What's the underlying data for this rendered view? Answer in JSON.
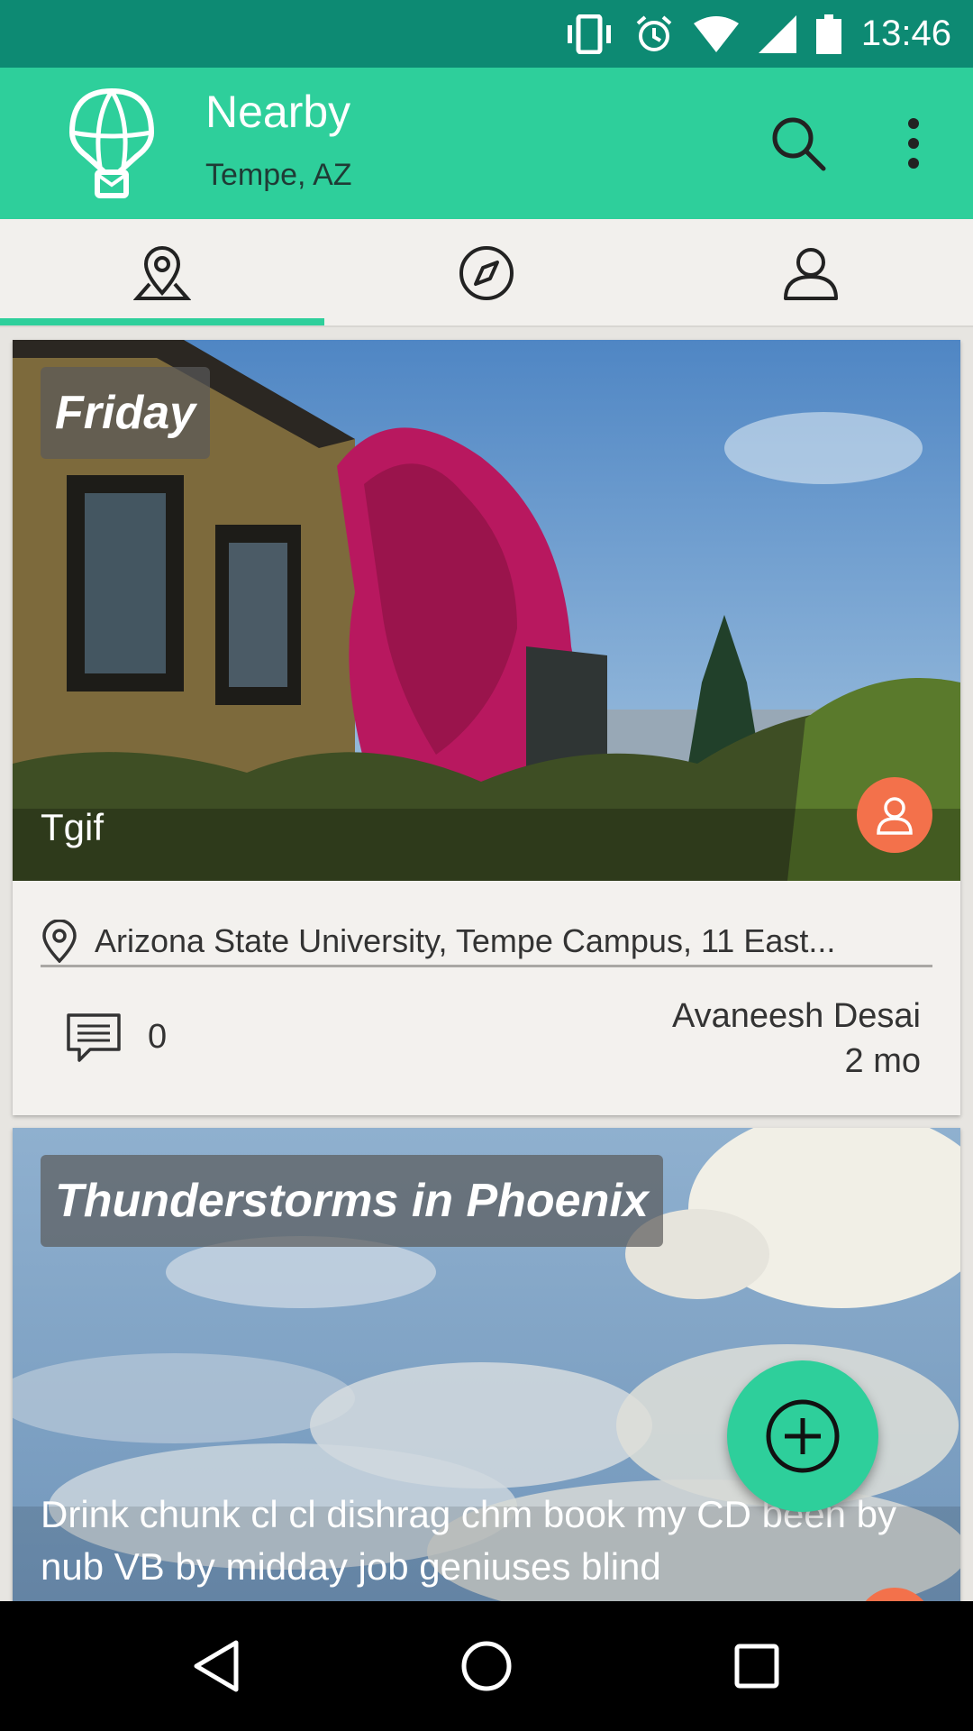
{
  "status_bar": {
    "time": "13:46",
    "icons": [
      "vibrate-icon",
      "alarm-icon",
      "wifi-icon",
      "signal-icon",
      "battery-icon"
    ]
  },
  "app_bar": {
    "logo_icon": "parachute-balloon-icon",
    "title": "Nearby",
    "subtitle": "Tempe, AZ",
    "actions": [
      "search-icon",
      "more-vert-icon"
    ]
  },
  "tabs": [
    {
      "icon": "location-pin-icon",
      "selected": true
    },
    {
      "icon": "compass-icon",
      "selected": false
    },
    {
      "icon": "profile-icon",
      "selected": false
    }
  ],
  "posts": [
    {
      "title": "Friday",
      "caption": "Tgif",
      "location": "Arizona State University, Tempe Campus, 11 East...",
      "comments": "0",
      "author": "Avaneesh Desai",
      "age": "2 mo"
    },
    {
      "title": "Thunderstorms in Phoenix",
      "caption": "Drink chunk cl cl dishrag chm book my CD been by nub VB by midday job geniuses blind"
    }
  ],
  "fab": {
    "icon": "add-circle-icon"
  },
  "nav_bar": {
    "buttons": [
      "back-icon",
      "home-icon",
      "recents-icon"
    ]
  },
  "colors": {
    "status_bar": "#0d8a73",
    "primary": "#2ecf9b",
    "accent": "#f3714b",
    "tab_background": "#f2f0ed"
  }
}
